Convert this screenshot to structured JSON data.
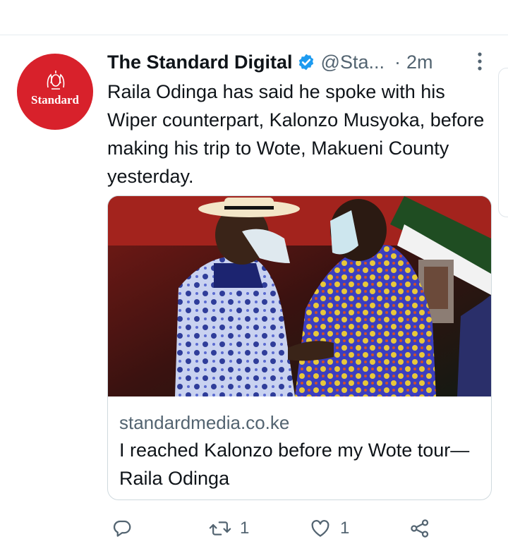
{
  "tweet": {
    "author_name": "The Standard Digital",
    "handle": "@Sta...",
    "separator": "·",
    "time": "2m",
    "text": "Raila Odinga has said he spoke with his Wiper counterpart, Kalonzo Musyoka, before making his trip to Wote, Makueni County yesterday.",
    "avatar_text": "Standard",
    "verified": true
  },
  "card": {
    "domain": "standardmedia.co.ke",
    "title": "I reached Kalonzo before my Wote tour— Raila Odinga"
  },
  "actions": {
    "reply_icon": "reply-icon",
    "retweet_icon": "retweet-icon",
    "retweet_count": "1",
    "like_icon": "heart-icon",
    "like_count": "1",
    "share_icon": "share-icon"
  },
  "colors": {
    "brand_red": "#d8212b",
    "verified_blue": "#1d9bf0",
    "secondary_text": "#536471"
  }
}
